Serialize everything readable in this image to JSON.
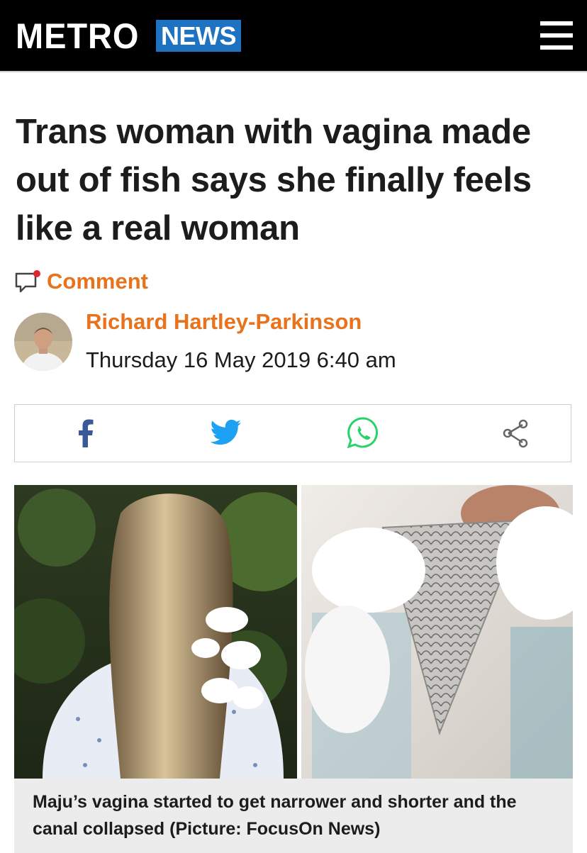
{
  "header": {
    "logo": "METRO",
    "section": "NEWS",
    "menu_icon": "hamburger-menu-icon"
  },
  "article": {
    "headline": "Trans woman with vagina made out of fish says she finally feels like a real woman",
    "comment_label": "Comment",
    "author": "Richard Hartley-Parkinson",
    "date": "Thursday 16 May 2019 6:40 am"
  },
  "share": {
    "icons": [
      "facebook-icon",
      "twitter-icon",
      "whatsapp-icon",
      "share-icon"
    ]
  },
  "image": {
    "caption": "Maju’s vagina started to get narrower and shorter and the canal collapsed (Picture: FocusOn News)"
  },
  "colors": {
    "accent_orange": "#e8731c",
    "section_blue": "#1e72c2",
    "facebook_blue": "#3b5998",
    "twitter_blue": "#1da1f2",
    "whatsapp_green": "#25d366"
  }
}
